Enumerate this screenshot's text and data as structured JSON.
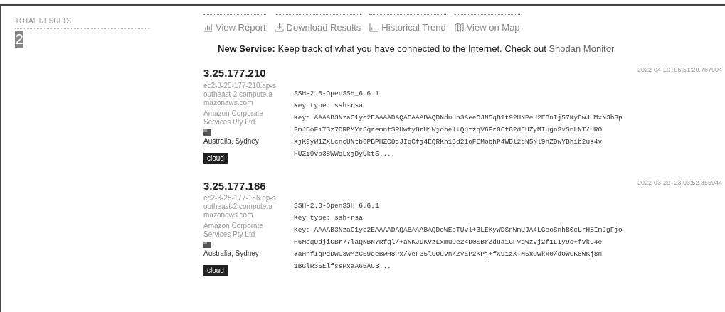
{
  "sidebar": {
    "title": "TOTAL RESULTS",
    "count": "2"
  },
  "actions": [
    {
      "label": "View Report",
      "kind": "report"
    },
    {
      "label": "Download Results",
      "kind": "download"
    },
    {
      "label": "Historical Trend",
      "kind": "trend"
    },
    {
      "label": "View on Map",
      "kind": "map"
    }
  ],
  "banner": {
    "lead": "New Service:",
    "text": "Keep track of what you have connected to the Internet. Check out",
    "link": "Shodan Monitor"
  },
  "results": [
    {
      "ip": "3.25.177.210",
      "hostname": "ec2-3-25-177-210.ap-southeast-2.compute.amazonaws.com",
      "org": "Amazon Corporate Services Pty Ltd",
      "location": "Australia, Sydney",
      "tags": [
        "cloud"
      ],
      "timestamp": "2022-04-10T06:51:20.787904",
      "banner_lines": [
        "SSH-2.0-OpenSSH_6.6.1",
        "Key type: ssh-rsa",
        "Key: AAAAB3NzaC1yc2EAAAADAQABAAABAQDNduHn3AeeOJN5qB1t92HNPeU2EBnIj57KyEwJUMxN3bSp",
        "FmJBoFiTSz7DRRMYr3qremnfSRUwfy8rU1Wjohel+QufzqV6Pr0CfG2dEUZyMIugnSvSnLNT/URO",
        "XjK9yW1ZXLcncUNtb0PBPHZC8cJIqCfj4EQRKh15d21oFEMobhP4WDl2qN5Nl9hZDwYBhib2us4v",
        "HUZi9vo38WWqLxjDyUkt5..."
      ]
    },
    {
      "ip": "3.25.177.186",
      "hostname": "ec2-3-25-177-186.ap-southeast-2.compute.amazonaws.com",
      "org": "Amazon Corporate Services Pty Ltd",
      "location": "Australia, Sydney",
      "tags": [
        "cloud"
      ],
      "timestamp": "2022-03-29T23:03:52.855944",
      "banner_lines": [
        "SSH-2.0-OpenSSH_6.6.1",
        "Key type: ssh-rsa",
        "Key: AAAAB3NzaC1yc2EAAAADAQABAAABAQDoWEoTUvl+3LEKyWDSnWmUJA4LGeoSnhB0cLrH8ImJgFjo",
        "H6McqUdjiGBr77laQNBN7Rfql/+aNKJ9KvzLxmuOe24D0SBrZdua1GFVqWzVj2f1LIy9o+fvkC4e",
        "YaHnfIgPdDwC3wMzCE9qeBwH8Px/VeF35lUOuVn/ZVEP2KPj+fX9izXTM5xOwkx0/dOWGK8WKj8n",
        "1BGlR35ElfssPxaA6BAC3..."
      ]
    }
  ]
}
